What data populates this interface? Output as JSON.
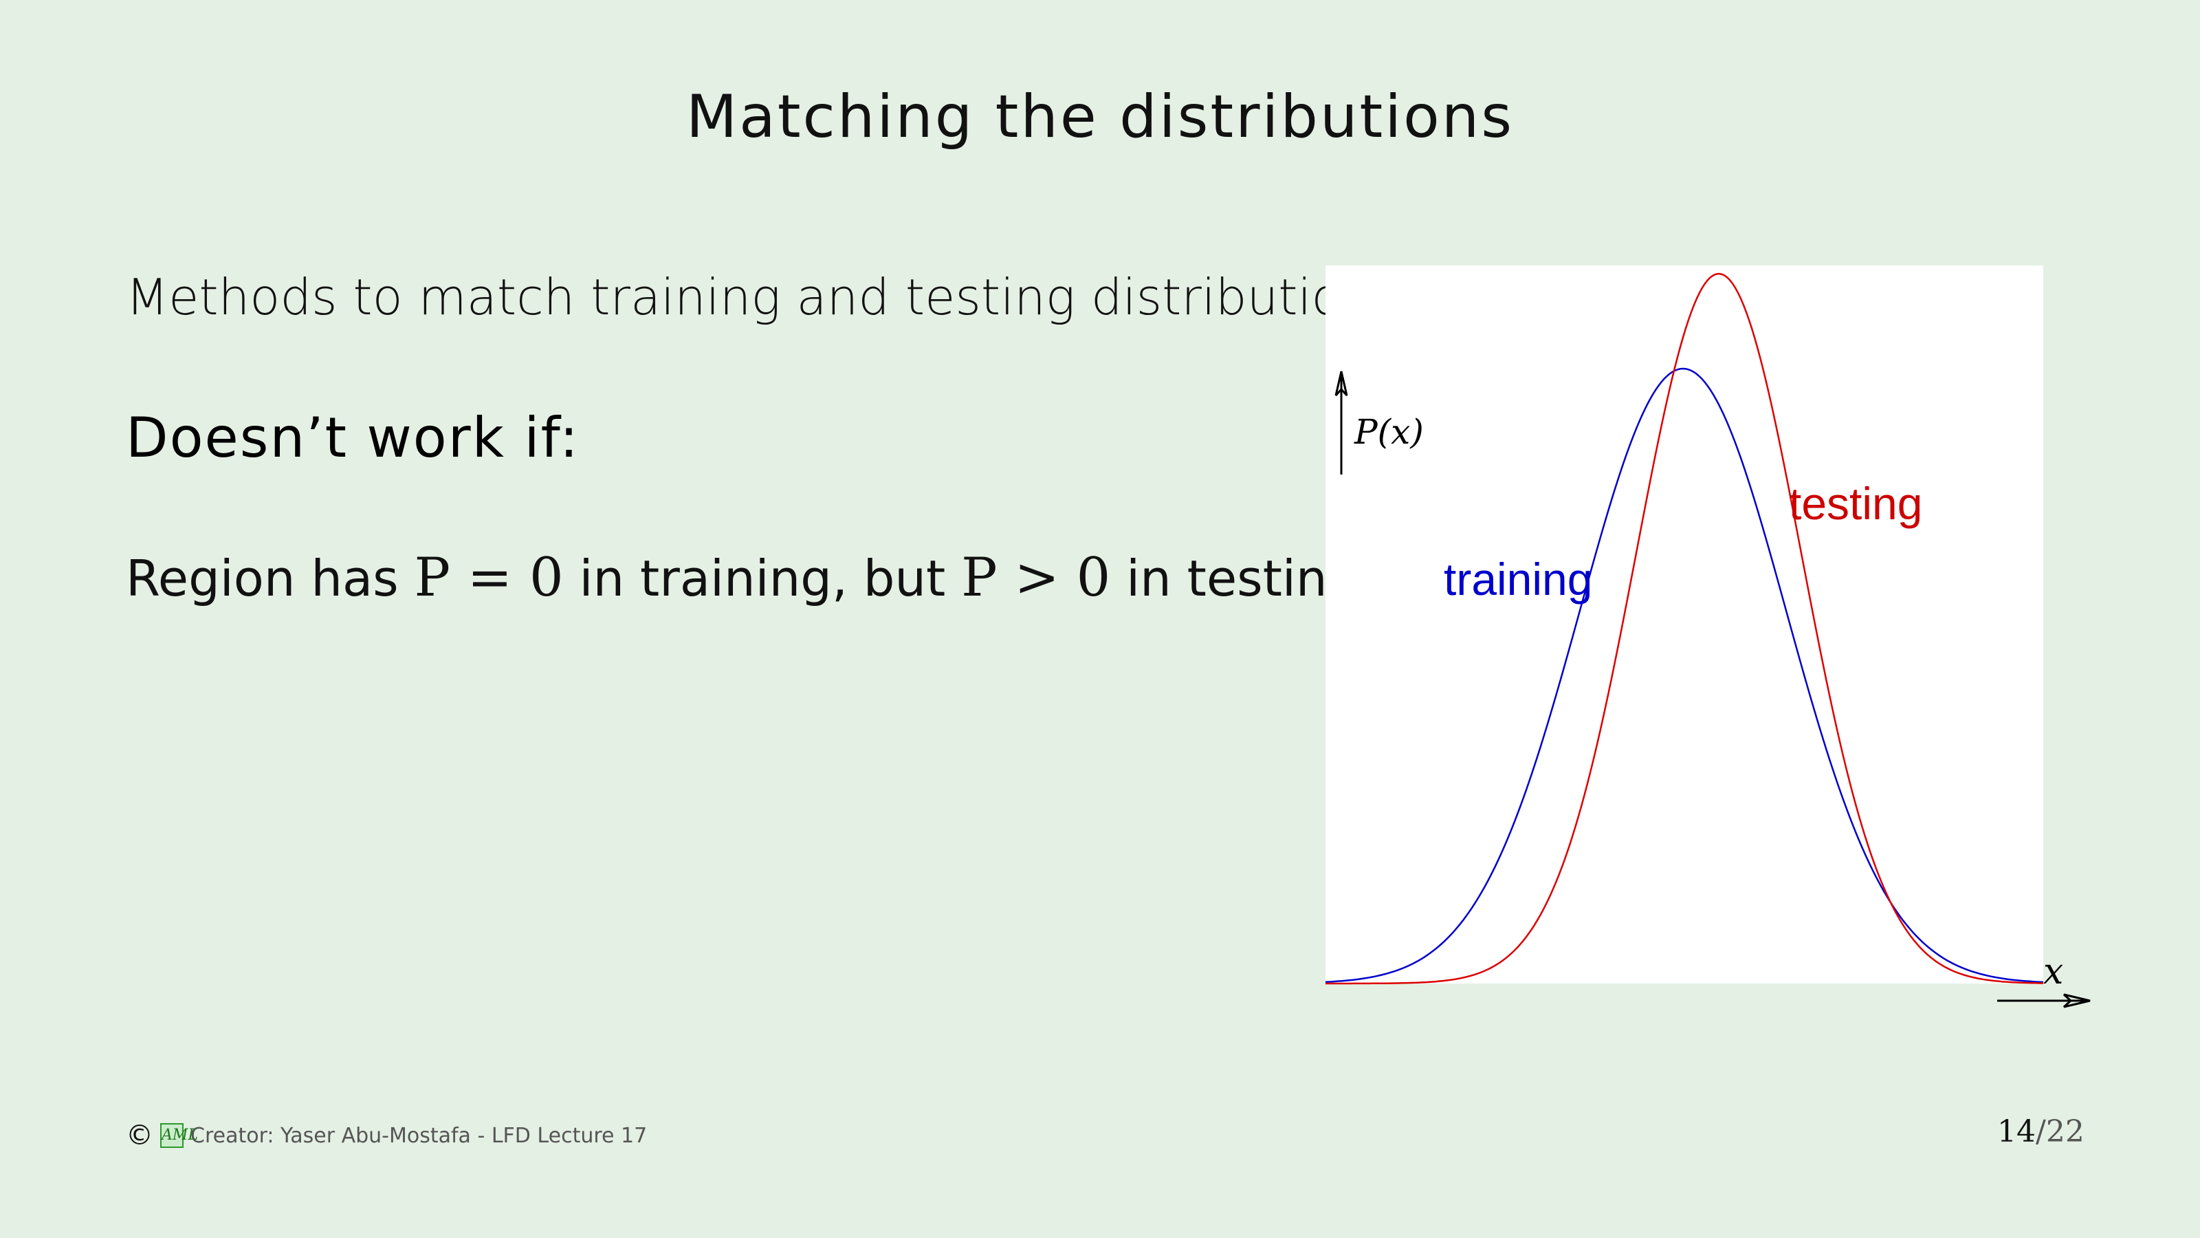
{
  "slide": {
    "title": "Matching the distributions",
    "line1": "Methods to match training and testing distributions",
    "heading": "Doesn’t work if:",
    "line2": {
      "pre": "Region has",
      "math1": "P = 0",
      "mid": "in training, but",
      "math2": "P > 0",
      "post": "in testing"
    }
  },
  "figure": {
    "ylabel": "P(x)",
    "xlabel": "x",
    "training_label": "training",
    "testing_label": "testing",
    "training_color": "#0000cc",
    "testing_color": "#cc0000"
  },
  "footer": {
    "copyright_symbol": "©",
    "logo_text": "AML",
    "creator": "Creator: Yaser Abu-Mostafa - LFD Lecture 17",
    "page_current": "14",
    "page_total": "/22"
  }
}
